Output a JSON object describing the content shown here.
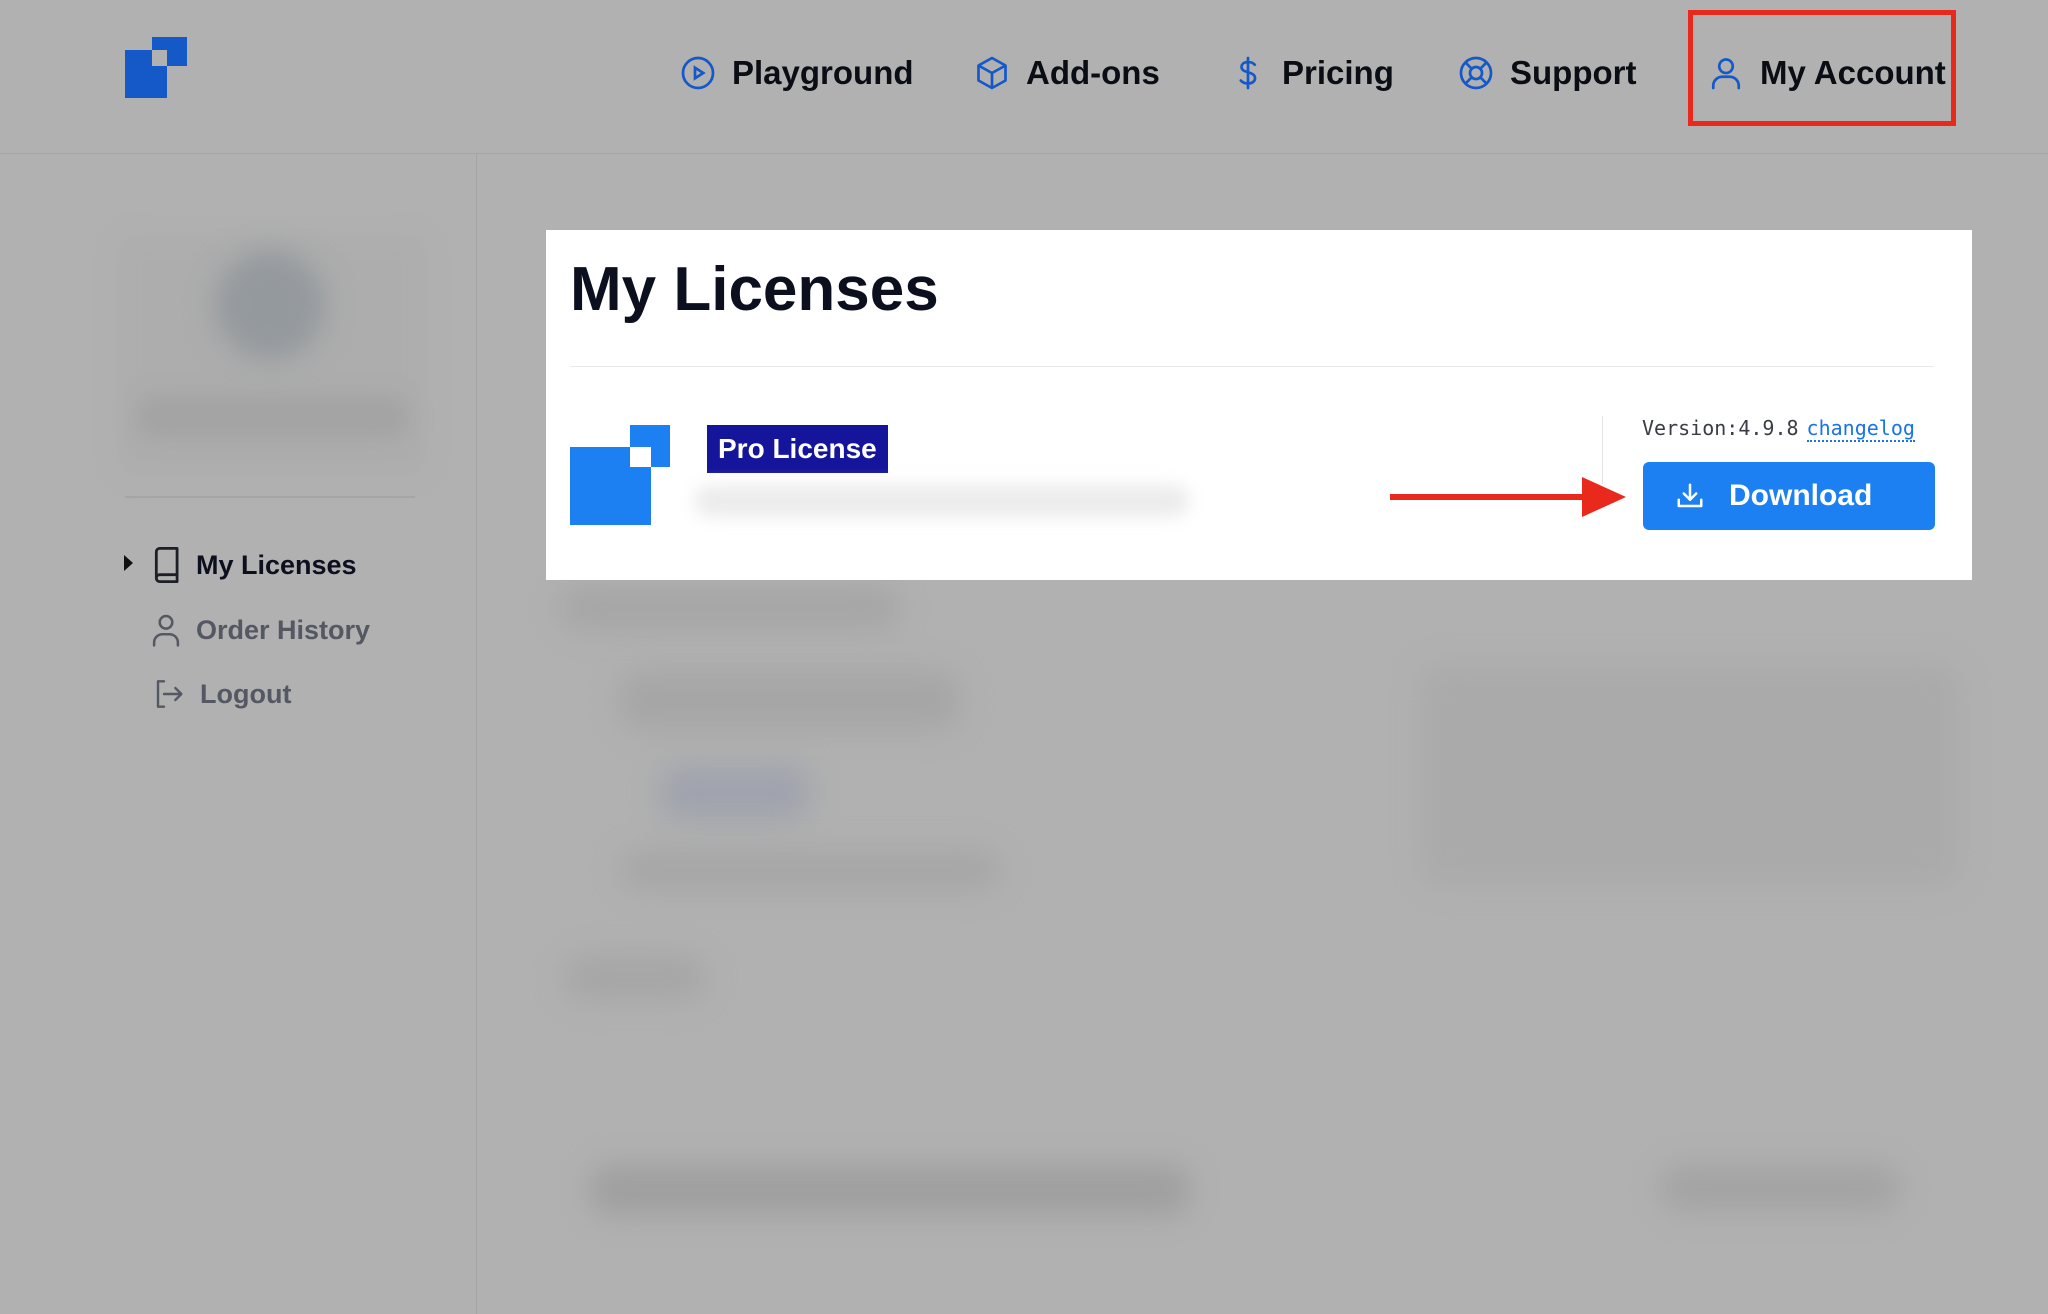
{
  "header": {
    "nav": [
      {
        "label": "Playground",
        "icon": "play-circle-icon"
      },
      {
        "label": "Add-ons",
        "icon": "cube-icon"
      },
      {
        "label": "Pricing",
        "icon": "dollar-icon"
      },
      {
        "label": "Support",
        "icon": "lifebuoy-icon"
      },
      {
        "label": "My Account",
        "icon": "user-icon"
      }
    ],
    "highlighted": "My Account"
  },
  "sidebar": {
    "items": [
      {
        "label": "My Licenses",
        "icon": "book-icon",
        "active": true
      },
      {
        "label": "Order History",
        "icon": "user-icon",
        "active": false
      },
      {
        "label": "Logout",
        "icon": "logout-icon",
        "active": false
      }
    ]
  },
  "main": {
    "title": "My Licenses",
    "license": {
      "badge": "Pro License",
      "version_label": "Version:",
      "version": "4.9.8",
      "changelog": "changelog",
      "download_label": "Download"
    }
  },
  "colors": {
    "brand": "#1c80f2",
    "brand_dark": "#1559c8",
    "badge": "#14159a",
    "highlight": "#e8291b",
    "overlay": "#b1b1b1"
  }
}
